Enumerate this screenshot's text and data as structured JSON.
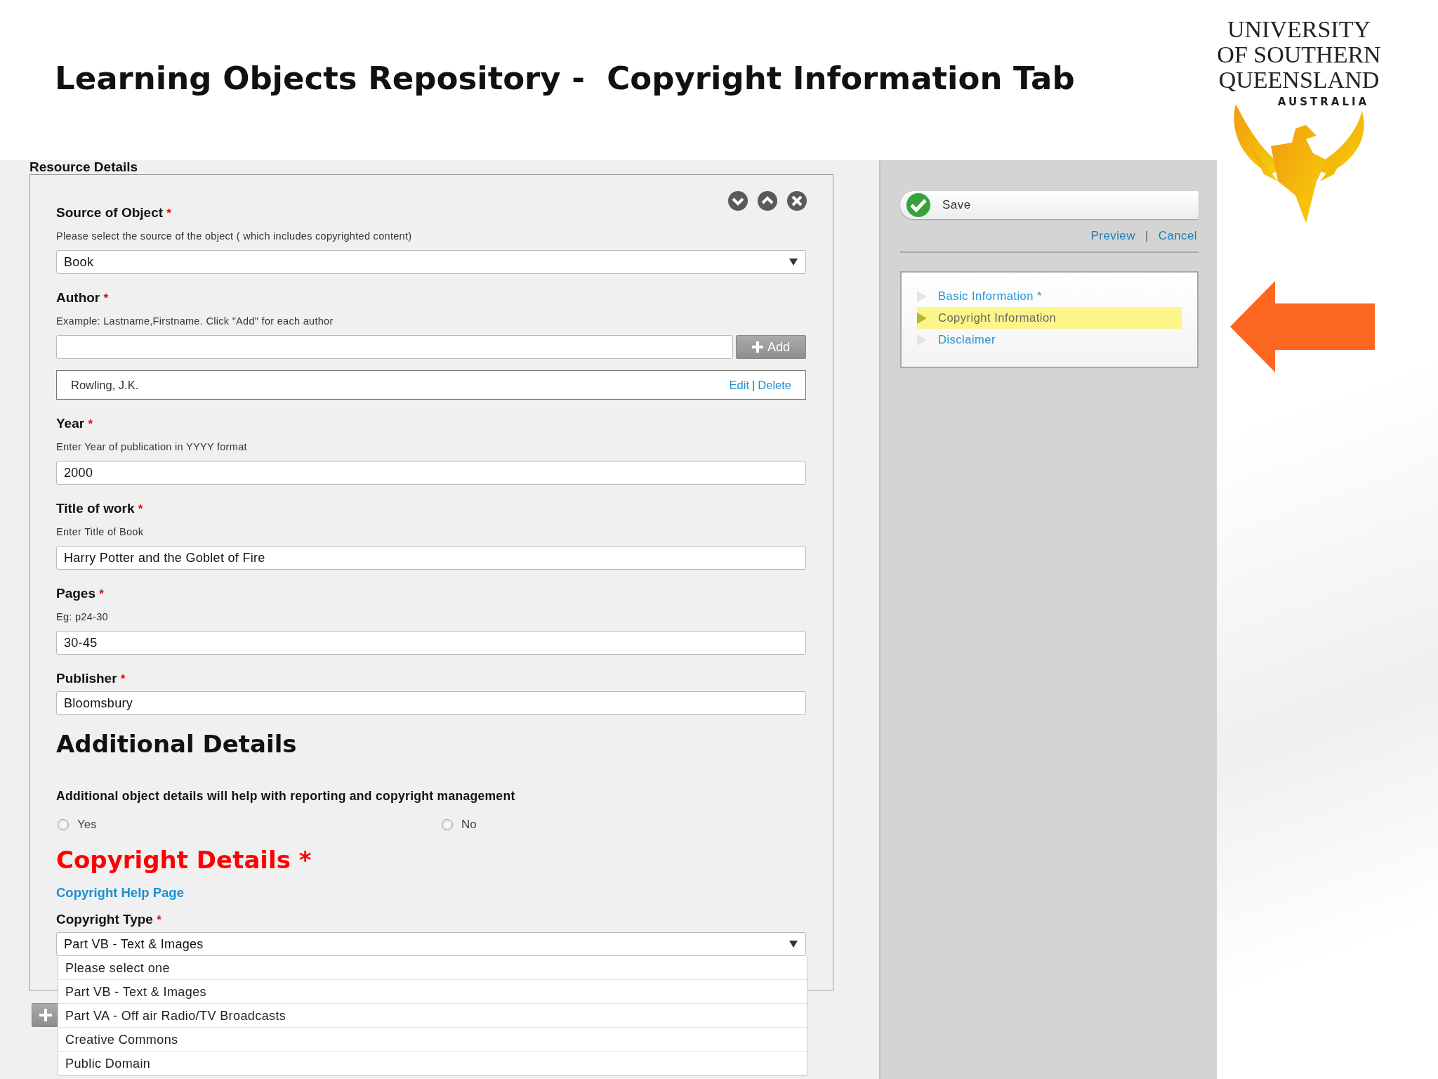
{
  "slide": {
    "title": "Learning Objects Repository -  Copyright Information Tab"
  },
  "logo": {
    "lines": [
      "UNIVERSITY",
      "OF SOUTHERN",
      "QUEENSLAND",
      "AUSTRALIA"
    ]
  },
  "section_heading": "Resource Details",
  "form": {
    "fields": [
      {
        "kind": "select",
        "label": "Source of Object",
        "required_mark": "*",
        "hint": "Please select the source of the object ( which includes copyrighted content)",
        "value": "Book"
      },
      {
        "kind": "add",
        "label": "Author",
        "required_mark": "*",
        "hint": "Example: Lastname,Firstname. Click \"Add\" for each author",
        "button": "Add",
        "entries": [
          {
            "name": "Rowling, J.K.",
            "edit": "Edit",
            "separator": "|",
            "delete": "Delete"
          }
        ]
      },
      {
        "kind": "text",
        "label": "Year",
        "required_mark": "*",
        "hint": "Enter Year of publication in YYYY format",
        "value": "2000"
      },
      {
        "kind": "text",
        "label": "Title of work",
        "required_mark": "*",
        "hint": "Enter Title of Book",
        "value": "Harry Potter and the Goblet of Fire"
      },
      {
        "kind": "text",
        "label": "Pages",
        "required_mark": "*",
        "hint": "Eg: p24-30",
        "value": "30-45"
      },
      {
        "kind": "text",
        "label": "Publisher",
        "required_mark": "*",
        "value": "Bloomsbury"
      }
    ]
  },
  "additional": {
    "heading": "Additional Details",
    "question": "Additional object details will help with reporting and copyright management",
    "options": [
      {
        "label": "Yes",
        "selected": false
      },
      {
        "label": "No",
        "selected": false
      }
    ]
  },
  "copyright": {
    "heading": "Copyright Details",
    "required_mark": "*",
    "help_link": "Copyright Help Page",
    "type_field": {
      "label": "Copyright Type",
      "required_mark": "*",
      "value": "Part VB - Text & Images",
      "expanded": true,
      "options": [
        "Please select one",
        "Part VB - Text & Images",
        "Part VA - Off air Radio/TV Broadcasts",
        "Creative Commons",
        "Public Domain"
      ]
    }
  },
  "sidebar": {
    "save": "Save",
    "links": [
      "Preview",
      "Cancel"
    ],
    "link_separator": "|",
    "nav": [
      {
        "label": "Basic Information *",
        "selected": false
      },
      {
        "label": "Copyright Information",
        "selected": true
      },
      {
        "label": "Disclaimer",
        "selected": false
      }
    ]
  }
}
